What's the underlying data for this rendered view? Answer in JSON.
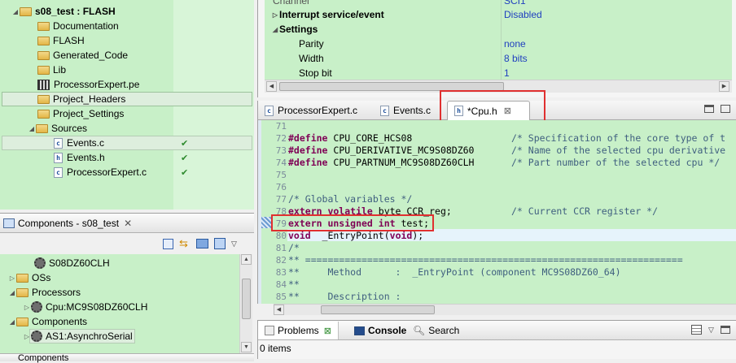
{
  "project_tree": {
    "project": "s08_test : FLASH",
    "items": [
      {
        "label": "Documentation",
        "type": "folder"
      },
      {
        "label": "FLASH",
        "type": "folder"
      },
      {
        "label": "Generated_Code",
        "type": "folder"
      },
      {
        "label": "Lib",
        "type": "folder"
      },
      {
        "label": "ProcessorExpert.pe",
        "type": "pe"
      },
      {
        "label": "Project_Headers",
        "type": "folder"
      },
      {
        "label": "Project_Settings",
        "type": "folder"
      },
      {
        "label": "Sources",
        "type": "folder"
      },
      {
        "label": "Events.c",
        "type": "c"
      },
      {
        "label": "Events.h",
        "type": "h"
      },
      {
        "label": "ProcessorExpert.c",
        "type": "c"
      }
    ]
  },
  "components_view": {
    "title": "Components - s08_test",
    "items": [
      {
        "label": "S08DZ60CLH"
      },
      {
        "label": "OSs"
      },
      {
        "label": "Processors"
      },
      {
        "label": "Cpu:MC9S08DZ60CLH"
      },
      {
        "label": "Components"
      },
      {
        "label": "AS1:AsynchroSerial"
      }
    ],
    "next_title": "Components"
  },
  "properties": {
    "rows": [
      {
        "name": "Channel",
        "value": "SCI1"
      },
      {
        "name": "Interrupt service/event",
        "value": "Disabled"
      },
      {
        "name": "Settings",
        "value": ""
      },
      {
        "name": "Parity",
        "value": "none"
      },
      {
        "name": "Width",
        "value": "8 bits"
      },
      {
        "name": "Stop bit",
        "value": "1"
      }
    ]
  },
  "editor": {
    "tabs": [
      "ProcessorExpert.c",
      "Events.c",
      "*Cpu.h"
    ],
    "line_numbers": [
      "71",
      "72",
      "73",
      "74",
      "75",
      "76",
      "77",
      "78",
      "79",
      "80",
      "81",
      "82",
      "83",
      "84",
      "85"
    ],
    "lines": {
      "l72a": "#define",
      "l72b": " CPU_CORE_HCS08",
      "l72c": "/* Specification of the core type of t",
      "l73a": "#define",
      "l73b": " CPU_DERIVATIVE_MC9S08DZ60",
      "l73c": "/* Name of the selected cpu derivative",
      "l74a": "#define",
      "l74b": " CPU_PARTNUM_MC9S08DZ60CLH",
      "l74c": "/* Part number of the selected cpu */",
      "l77": "/* Global variables */",
      "l78a": "extern volatile",
      "l78b": " byte CCR_reg;",
      "l78c": "/* Current CCR register */",
      "l79a": "extern unsigned int",
      "l79b": " test;",
      "l80a": "void",
      "l80b": "  _EntryPoint(",
      "l80c": "void",
      "l80d": ");",
      "l81": "/*",
      "l82": "** ===================================================================",
      "l83": "**     Method      :  _EntryPoint (component MC9S08DZ60_64)",
      "l84": "**",
      "l85": "**     Description :"
    }
  },
  "bottom_panel": {
    "tabs": [
      "Problems",
      "Console",
      "Search"
    ],
    "status": "0 items"
  }
}
